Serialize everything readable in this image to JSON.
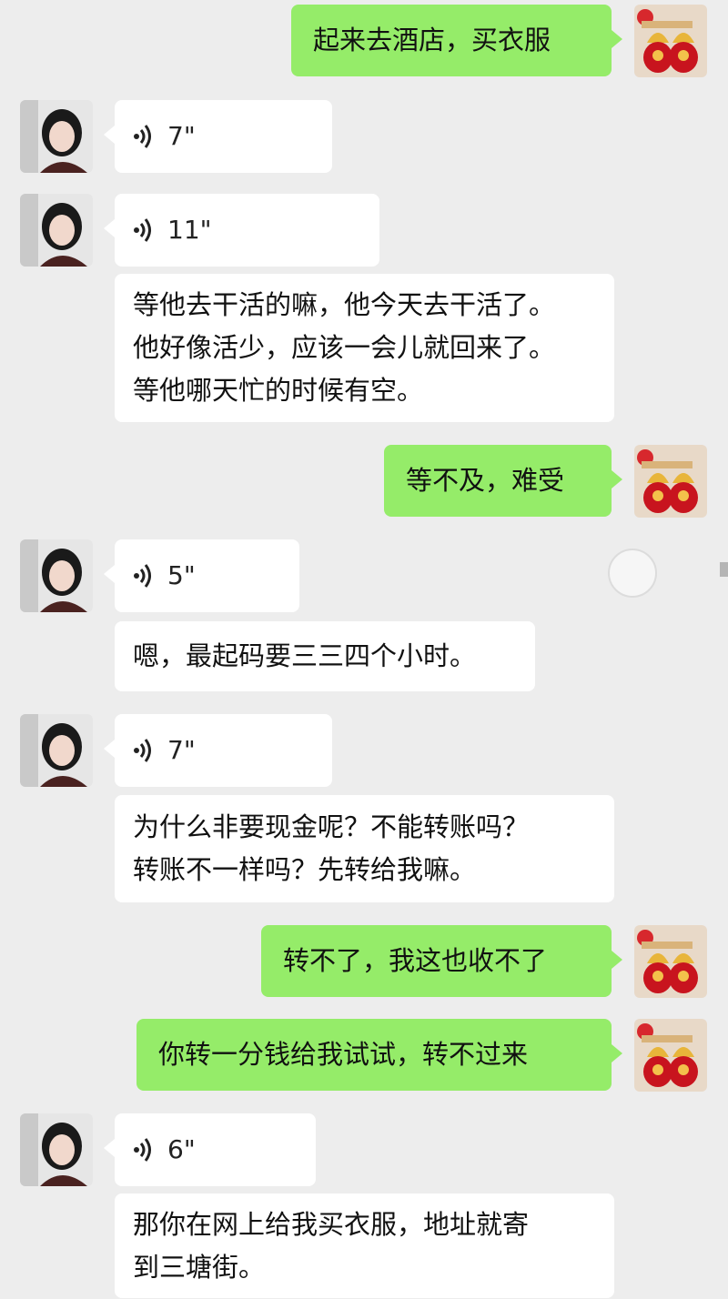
{
  "messages": [
    {
      "side": "out",
      "type": "text",
      "text": "起来去酒店，买衣服"
    },
    {
      "side": "in",
      "type": "voice",
      "duration": "7\""
    },
    {
      "side": "in",
      "type": "voice",
      "duration": "11\""
    },
    {
      "side": "in",
      "type": "text",
      "text": "等他去干活的嘛，他今天去干活了。\n他好像活少，应该一会儿就回来了。\n等他哪天忙的时候有空。"
    },
    {
      "side": "out",
      "type": "text",
      "text": "等不及，难受"
    },
    {
      "side": "in",
      "type": "voice",
      "duration": "5\""
    },
    {
      "side": "in",
      "type": "text",
      "text": "嗯，最起码要三三四个小时。"
    },
    {
      "side": "in",
      "type": "voice",
      "duration": "7\""
    },
    {
      "side": "in",
      "type": "text",
      "text": "为什么非要现金呢？不能转账吗？\n转账不一样吗？先转给我嘛。"
    },
    {
      "side": "out",
      "type": "text",
      "text": "转不了，我这也收不了"
    },
    {
      "side": "out",
      "type": "text",
      "text": "你转一分钱给我试试，转不过来"
    },
    {
      "side": "in",
      "type": "voice",
      "duration": "6\""
    },
    {
      "side": "in",
      "type": "text",
      "text": "那你在网上给我买衣服，地址就寄\n到三塘街。"
    }
  ],
  "icons": {
    "voice": "voice-wave-icon",
    "contact_avatar": "woman-portrait-avatar",
    "self_avatar": "lucky-bag-avatar"
  },
  "colors": {
    "background": "#ededed",
    "incoming_bubble": "#ffffff",
    "outgoing_bubble": "#95ec69"
  }
}
